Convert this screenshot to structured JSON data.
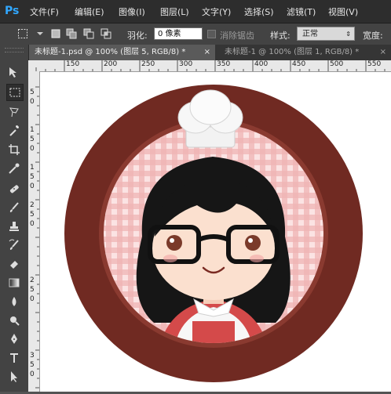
{
  "app": {
    "logo": "Ps"
  },
  "menus": [
    "文件(F)",
    "编辑(E)",
    "图像(I)",
    "图层(L)",
    "文字(Y)",
    "选择(S)",
    "滤镜(T)",
    "视图(V)"
  ],
  "options": {
    "feather_label": "羽化:",
    "feather_value": "0 像素",
    "antialias_label": "消除锯齿",
    "style_label": "样式:",
    "style_value": "正常",
    "width_label": "宽度:"
  },
  "tabs": [
    {
      "label": "未标题-1.psd @ 100% (图层 5, RGB/8) *",
      "close": "×"
    },
    {
      "label": "未标题-1 @ 100% (图层 1, RGB/8) *",
      "close": "×"
    }
  ],
  "ruler": {
    "horizontal": [
      "150",
      "200",
      "250",
      "300",
      "350",
      "400",
      "450",
      "500",
      "550"
    ],
    "vertical": [
      "5",
      "0",
      "1",
      "5",
      "0",
      "1",
      "5",
      "0",
      "2",
      "5",
      "0",
      "2",
      "5",
      "0",
      "3",
      "5",
      "0"
    ]
  },
  "tools": [
    "move-tool-icon",
    "marquee-tool-icon",
    "lasso-tool-icon",
    "magic-wand-icon",
    "crop-tool-icon",
    "eyedropper-icon",
    "healing-brush-icon",
    "brush-tool-icon",
    "clone-stamp-icon",
    "history-brush-icon",
    "eraser-icon",
    "gradient-icon",
    "blur-tool-icon",
    "dodge-tool-icon",
    "pen-tool-icon",
    "type-tool-icon",
    "path-selection-icon"
  ],
  "colors": {
    "frame": "#702a22",
    "frame_inner": "#7a2f25",
    "gingham_light": "#fbe3e3",
    "gingham_dark": "#e9a8a8",
    "hair": "#1a1a1a",
    "skin": "#fbe0cf",
    "apron": "#d24a4a",
    "hat": "#f2f2f2"
  }
}
